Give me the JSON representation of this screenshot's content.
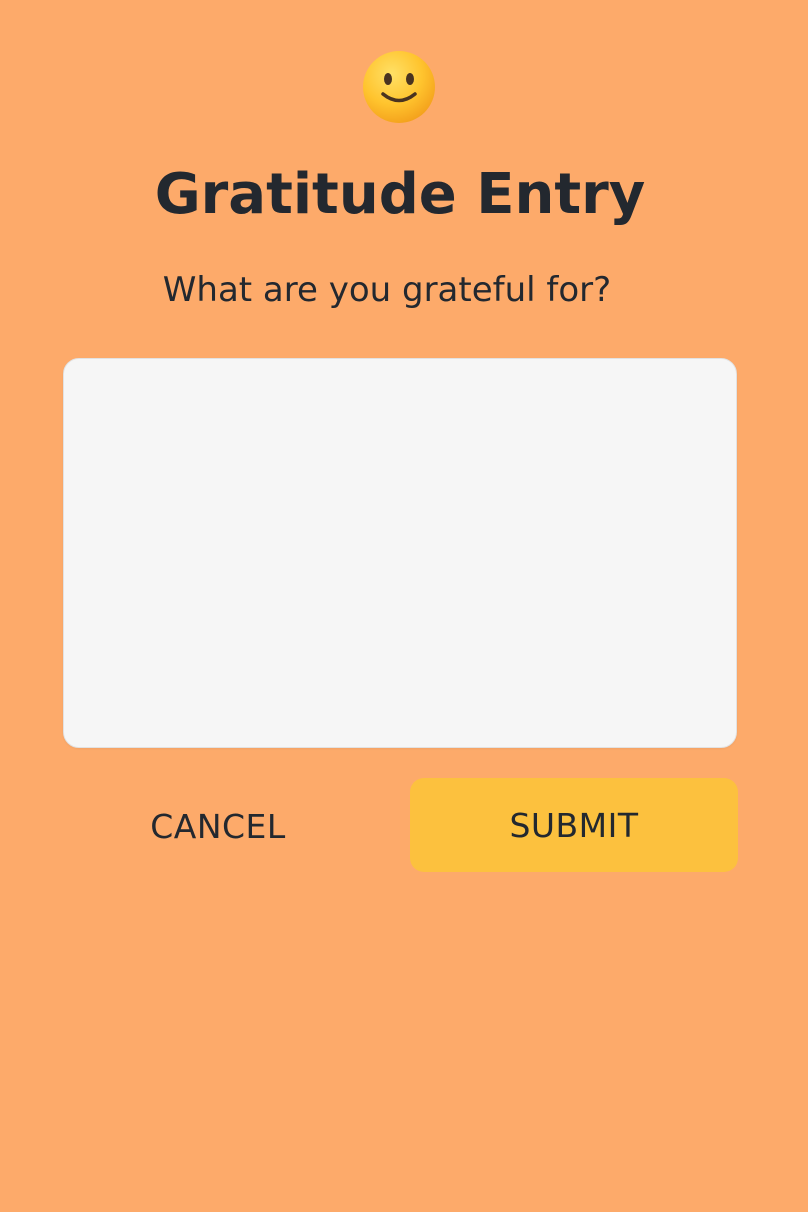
{
  "header": {
    "icon": "smiling-face-icon",
    "title": "Gratitude Entry",
    "prompt": "What are you grateful for?"
  },
  "entry": {
    "value": "",
    "placeholder": ""
  },
  "actions": {
    "cancel_label": "CANCEL",
    "submit_label": "SUBMIT"
  },
  "colors": {
    "background": "#FDAA6A",
    "text": "#23282F",
    "input_background": "#F6F6F6",
    "submit_background": "#FCC13E",
    "emoji_face": "#FFC42E"
  }
}
